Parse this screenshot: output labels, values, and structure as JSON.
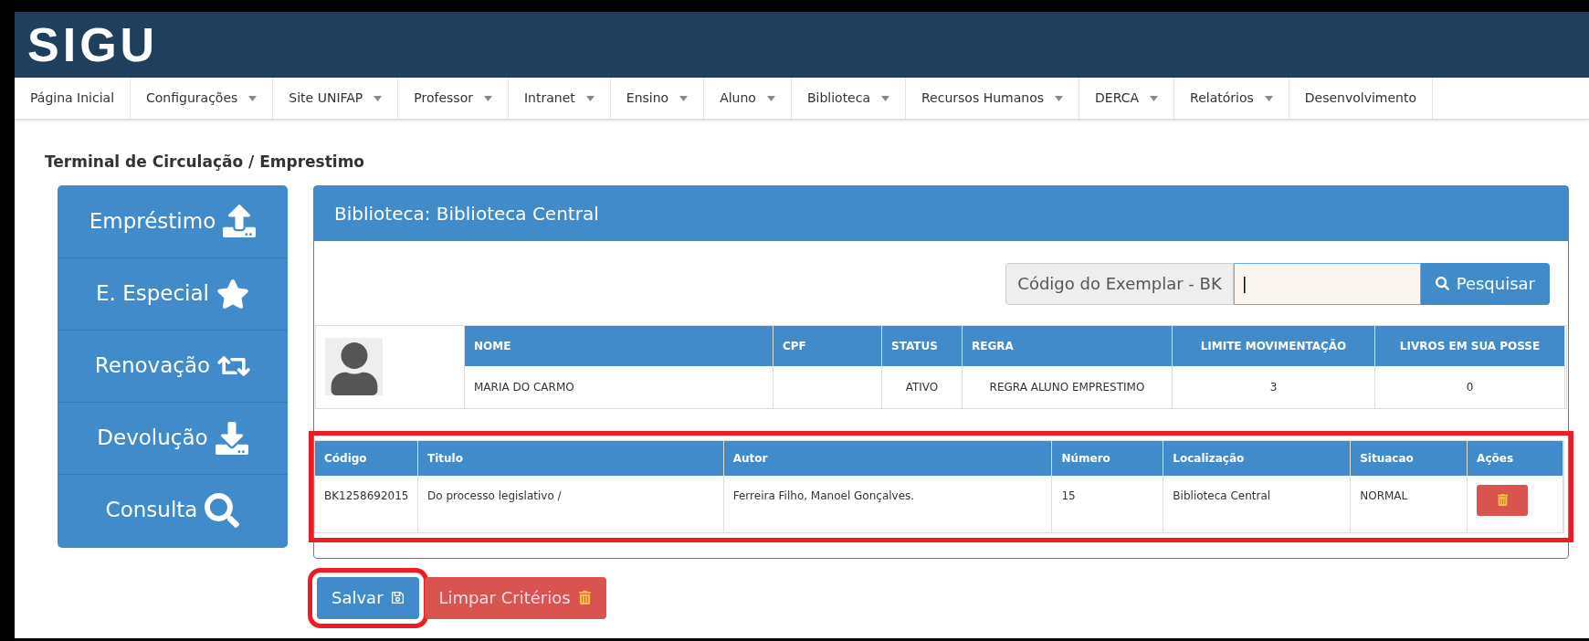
{
  "header": {
    "logo": "SIGU"
  },
  "nav": [
    {
      "label": "Página Inicial",
      "has_dropdown": false
    },
    {
      "label": "Configurações",
      "has_dropdown": true
    },
    {
      "label": "Site UNIFAP",
      "has_dropdown": true
    },
    {
      "label": "Professor",
      "has_dropdown": true
    },
    {
      "label": "Intranet",
      "has_dropdown": true
    },
    {
      "label": "Ensino",
      "has_dropdown": true
    },
    {
      "label": "Aluno",
      "has_dropdown": true
    },
    {
      "label": "Biblioteca",
      "has_dropdown": true
    },
    {
      "label": "Recursos Humanos",
      "has_dropdown": true
    },
    {
      "label": "DERCA",
      "has_dropdown": true
    },
    {
      "label": "Relatórios",
      "has_dropdown": true
    },
    {
      "label": "Desenvolvimento",
      "has_dropdown": false
    }
  ],
  "page_title": "Terminal de Circulação / Emprestimo",
  "sidebar": [
    {
      "label": "Empréstimo",
      "kind": "upload"
    },
    {
      "label": "E. Especial",
      "kind": "star"
    },
    {
      "label": "Renovação",
      "kind": "renew"
    },
    {
      "label": "Devolução",
      "kind": "download"
    },
    {
      "label": "Consulta",
      "kind": "search"
    }
  ],
  "panel": {
    "title": "Biblioteca: Biblioteca Central",
    "search": {
      "label": "Código do Exemplar - BK",
      "value": "|",
      "button": "Pesquisar"
    },
    "user_table": {
      "columns": [
        {
          "label": "NOME",
          "value": "MARIA DO CARMO"
        },
        {
          "label": "CPF"
        },
        {
          "label": "STATUS",
          "value": "ATIVO"
        },
        {
          "label": "REGRA",
          "value": "REGRA ALUNO EMPRESTIMO"
        },
        {
          "label": "LIMITE MOVIMENTAÇÃO",
          "value": "3"
        },
        {
          "label": "LIVROS EM SUA POSSE",
          "value": "0"
        }
      ]
    },
    "items_table": {
      "highlighted": true,
      "columns": [
        "Código",
        "Titulo",
        "Autor",
        "Número",
        "Localização",
        "Situacao",
        "Ações"
      ],
      "rows": [
        [
          "BK1258692015",
          "Do processo legislativo /",
          "Ferreira Filho, Manoel Gonçalves.",
          "15",
          "Biblioteca Central",
          "NORMAL"
        ]
      ]
    }
  },
  "buttons": [
    {
      "label": "Salvar",
      "kind": "save",
      "highlighted": true
    },
    {
      "label": "Limpar Critérios",
      "kind": "clear",
      "highlighted": false
    }
  ]
}
